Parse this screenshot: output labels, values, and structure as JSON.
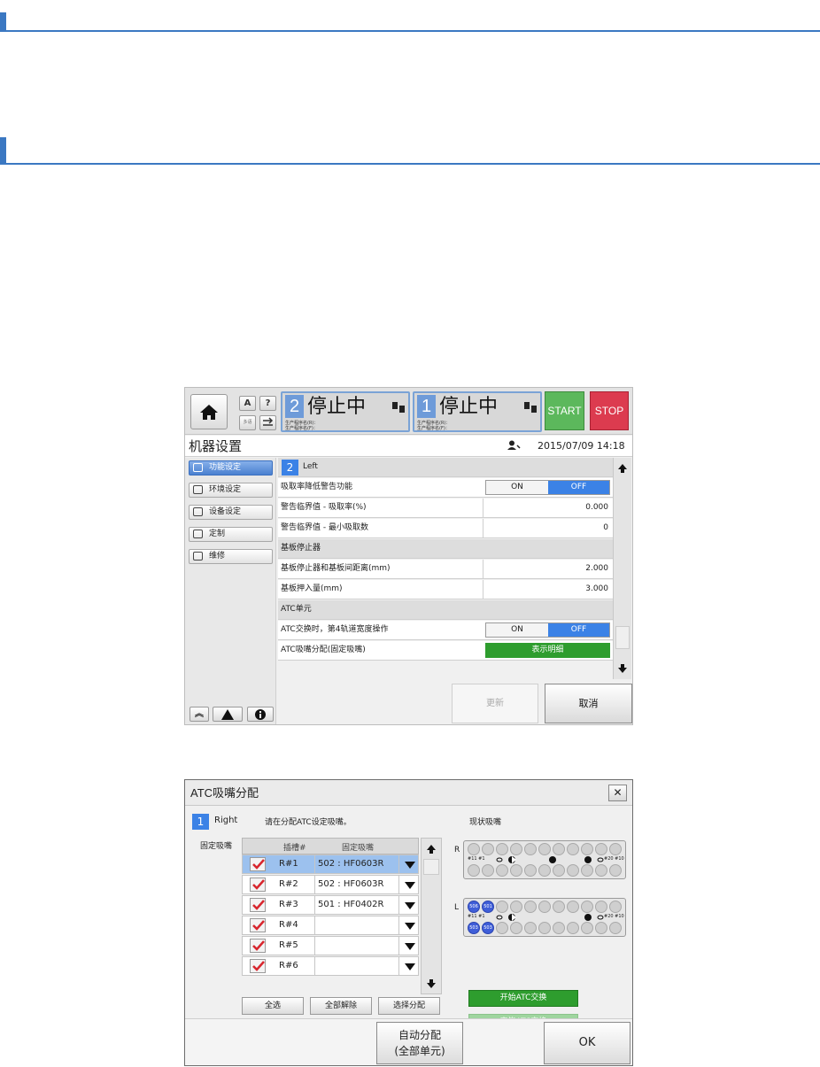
{
  "screen1": {
    "lanes": [
      {
        "number": "2",
        "status": "停止中",
        "sub1": "生产程序名(R)：",
        "sub2": "生产程序名(F)："
      },
      {
        "number": "1",
        "status": "停止中",
        "sub1": "生产程序名(R)：",
        "sub2": "生产程序名(F)："
      }
    ],
    "small_btn_a": "A",
    "small_btn_help": "?",
    "small_btn_multi": "多语",
    "start_label": "START",
    "stop_label": "STOP",
    "title": "机器设置",
    "datetime": "2015/07/09 14:18",
    "sidebar": {
      "items": [
        {
          "label": "功能设定"
        },
        {
          "label": "环境设定"
        },
        {
          "label": "设备设定"
        },
        {
          "label": "定制"
        },
        {
          "label": "维修"
        }
      ]
    },
    "lane_header": {
      "number": "2",
      "label": "Left"
    },
    "rows": [
      {
        "label": "吸取率降低警告功能",
        "on": "ON",
        "off": "OFF"
      },
      {
        "label": "警告临界值 - 吸取率(%)",
        "value": "0.000"
      },
      {
        "label": "警告临界值 - 最小吸取数",
        "value": "0"
      },
      {
        "label": "基板停止器"
      },
      {
        "label": "基板停止器和基板间距离(mm)",
        "value": "2.000"
      },
      {
        "label": "基板押入量(mm)",
        "value": "3.000"
      },
      {
        "label": "ATC单元"
      },
      {
        "label": "ATC交换时，第4轨道宽度操作",
        "on": "ON",
        "off": "OFF"
      },
      {
        "label": "ATC吸嘴分配(固定吸嘴)",
        "button": "表示明细"
      }
    ],
    "update_label": "更新",
    "cancel_label": "取消"
  },
  "screen2": {
    "title": "ATC吸嘴分配",
    "lane_number": "1",
    "lane_label": "Right",
    "instruction": "请在分配ATC设定吸嘴。",
    "current_nozzle_label": "现状吸嘴",
    "fixed_nozzle_label": "固定吸嘴",
    "columns": {
      "slot": "插槽#",
      "nozzle": "固定吸嘴"
    },
    "rows": [
      {
        "slot": "R#1",
        "nozzle": "502 : HF0603R"
      },
      {
        "slot": "R#2",
        "nozzle": "502 : HF0603R"
      },
      {
        "slot": "R#3",
        "nozzle": "501 : HF0402R"
      },
      {
        "slot": "R#4",
        "nozzle": ""
      },
      {
        "slot": "R#5",
        "nozzle": ""
      },
      {
        "slot": "R#6",
        "nozzle": ""
      }
    ],
    "select_all": "全选",
    "deselect_all": "全部解除",
    "select_assign": "选择分配",
    "panel_r_label": "R",
    "panel_l_label": "L",
    "panel_tag_left": "#11 #1",
    "panel_tag_right": "#20 #10",
    "panel_l_blue": [
      "506",
      "501",
      "503",
      "503"
    ],
    "atc_start": "开始ATC交换",
    "atc_end": "完毕ATC交换",
    "auto_assign_1": "自动分配",
    "auto_assign_2": "(全部单元)",
    "ok_label": "OK"
  }
}
